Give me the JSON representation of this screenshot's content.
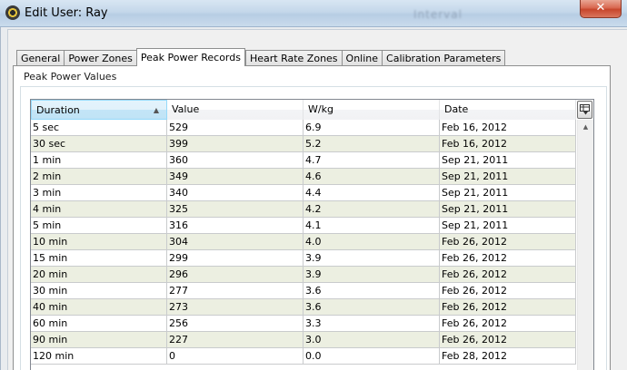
{
  "window": {
    "title": "Edit User: Ray",
    "background_title": "Interval",
    "close_label": "✕"
  },
  "tabs": [
    {
      "label": "General"
    },
    {
      "label": "Power Zones"
    },
    {
      "label": "Peak Power Records",
      "active": true
    },
    {
      "label": "Heart Rate Zones"
    },
    {
      "label": "Online"
    },
    {
      "label": "Calibration Parameters"
    }
  ],
  "group": {
    "label": "Peak Power Values"
  },
  "table": {
    "columns": [
      "Duration",
      "Value",
      "W/kg",
      "Date"
    ],
    "sorted_column": "Duration",
    "rows": [
      [
        "5 sec",
        "529",
        "6.9",
        "Feb 16, 2012"
      ],
      [
        "30 sec",
        "399",
        "5.2",
        "Feb 16, 2012"
      ],
      [
        "1 min",
        "360",
        "4.7",
        "Sep 21, 2011"
      ],
      [
        "2 min",
        "349",
        "4.6",
        "Sep 21, 2011"
      ],
      [
        "3 min",
        "340",
        "4.4",
        "Sep 21, 2011"
      ],
      [
        "4 min",
        "325",
        "4.2",
        "Sep 21, 2011"
      ],
      [
        "5 min",
        "316",
        "4.1",
        "Sep 21, 2011"
      ],
      [
        "10 min",
        "304",
        "4.0",
        "Feb 26, 2012"
      ],
      [
        "15 min",
        "299",
        "3.9",
        "Feb 26, 2012"
      ],
      [
        "20 min",
        "296",
        "3.9",
        "Feb 26, 2012"
      ],
      [
        "30 min",
        "277",
        "3.6",
        "Feb 26, 2012"
      ],
      [
        "40 min",
        "273",
        "3.6",
        "Feb 26, 2012"
      ],
      [
        "60 min",
        "256",
        "3.3",
        "Feb 26, 2012"
      ],
      [
        "90 min",
        "227",
        "3.0",
        "Feb 26, 2012"
      ],
      [
        "120 min",
        "0",
        "0.0",
        "Feb 28, 2012"
      ]
    ]
  },
  "colors": {
    "row_alt": "#ecefe1",
    "header_sorted": "#c3e5f7"
  },
  "icons": {
    "app": "app-logo-icon",
    "column_chooser": "column-chooser-icon",
    "sort": "sort-ascending-icon",
    "scroll_up": "scroll-up-icon"
  }
}
